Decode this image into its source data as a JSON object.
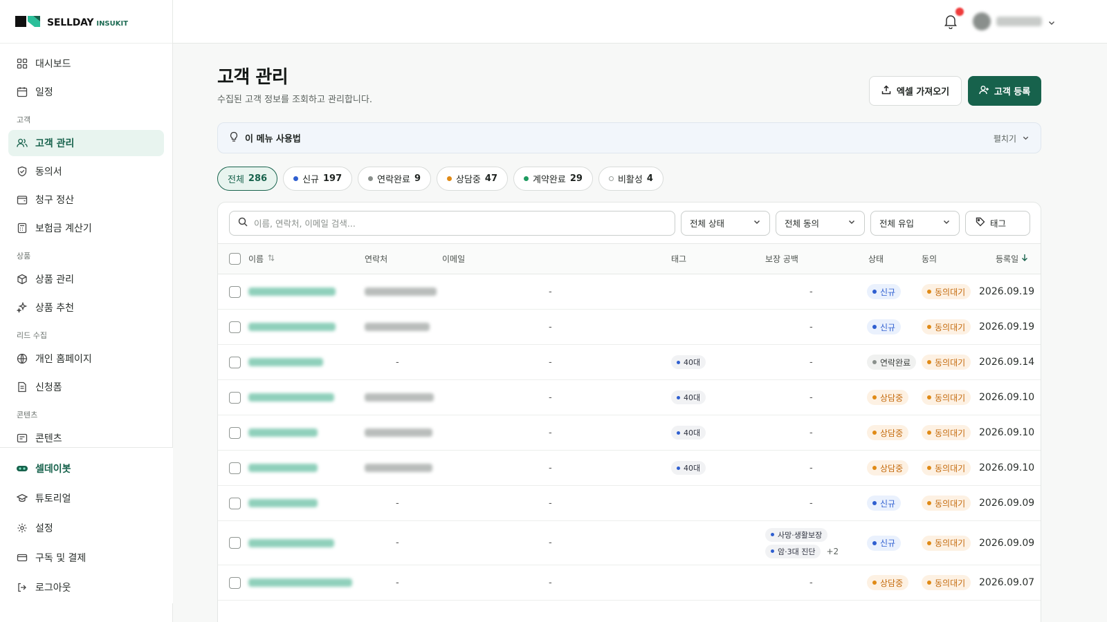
{
  "brand": {
    "name": "SELLDAY",
    "sub": "INSUKIT",
    "color": "#17624c"
  },
  "sidebar": {
    "items_top": [
      {
        "label": "대시보드",
        "icon": "grid-icon"
      },
      {
        "label": "일정",
        "icon": "calendar-icon"
      }
    ],
    "section_customer": "고객",
    "items_customer": [
      {
        "label": "고객 관리",
        "icon": "users-icon",
        "active": true
      },
      {
        "label": "동의서",
        "icon": "shield-icon"
      },
      {
        "label": "청구 정산",
        "icon": "wallet-icon"
      },
      {
        "label": "보험금 계산기",
        "icon": "calculator-icon"
      }
    ],
    "section_product": "상품",
    "items_product": [
      {
        "label": "상품 관리",
        "icon": "box-icon"
      },
      {
        "label": "상품 추천",
        "icon": "sparkle-icon"
      }
    ],
    "section_lead": "리드 수집",
    "items_lead": [
      {
        "label": "개인 홈페이지",
        "icon": "globe-icon"
      },
      {
        "label": "신청폼",
        "icon": "form-icon"
      }
    ],
    "section_content": "콘텐츠",
    "items_content": [
      {
        "label": "콘텐츠",
        "icon": "content-icon"
      }
    ],
    "bottom": [
      {
        "label": "셀데이봇",
        "icon": "bot-icon"
      },
      {
        "label": "튜토리얼",
        "icon": "graduation-icon"
      },
      {
        "label": "설정",
        "icon": "gear-icon"
      },
      {
        "label": "구독 및 결제",
        "icon": "card-icon"
      },
      {
        "label": "로그아웃",
        "icon": "logout-icon"
      }
    ]
  },
  "header": {
    "title": "고객 관리",
    "desc": "수집된 고객 정보를 조회하고 관리합니다.",
    "excel_btn": "엑셀 가져오기",
    "register_btn": "고객 등록"
  },
  "guide": {
    "label": "이 메뉴 사용법",
    "toggle": "펼치기"
  },
  "chips": [
    {
      "label": "전체",
      "count": "286",
      "dot": "",
      "active": true
    },
    {
      "label": "신규",
      "count": "197",
      "dot": "#2f5fd0"
    },
    {
      "label": "연락완료",
      "count": "9",
      "dot": "#8a908c"
    },
    {
      "label": "상담중",
      "count": "47",
      "dot": "#e08a16"
    },
    {
      "label": "계약완료",
      "count": "29",
      "dot": "#1e9a5f"
    },
    {
      "label": "비활성",
      "count": "4",
      "dot": "hollow"
    }
  ],
  "filters": {
    "search_placeholder": "이름, 연락처, 이메일 검색...",
    "status": "전체 상태",
    "consent": "전체 동의",
    "source": "전체 유입",
    "tag": "태그"
  },
  "table": {
    "columns": {
      "name": "이름",
      "phone": "연락처",
      "email": "이메일",
      "tag": "태그",
      "gap": "보장 공백",
      "status": "상태",
      "consent": "동의",
      "date": "등록일"
    },
    "rows": [
      {
        "phone": true,
        "email": "-",
        "tags": [],
        "gap": "-",
        "status": "신규",
        "consent": "동의대기",
        "date": "2026.09.19"
      },
      {
        "phone": true,
        "email": "-",
        "tags": [],
        "gap": "-",
        "status": "신규",
        "consent": "동의대기",
        "date": "2026.09.19"
      },
      {
        "phone": false,
        "email": "-",
        "tags": [
          "40대"
        ],
        "gap": "-",
        "status": "연락완료",
        "consent": "동의대기",
        "date": "2026.09.14"
      },
      {
        "phone": true,
        "email": "-",
        "tags": [
          "40대"
        ],
        "gap": "-",
        "status": "상담중",
        "consent": "동의대기",
        "date": "2026.09.10"
      },
      {
        "phone": true,
        "email": "-",
        "tags": [
          "40대"
        ],
        "gap": "-",
        "status": "상담중",
        "consent": "동의대기",
        "date": "2026.09.10"
      },
      {
        "phone": true,
        "email": "-",
        "tags": [
          "40대"
        ],
        "gap": "-",
        "status": "상담중",
        "consent": "동의대기",
        "date": "2026.09.10"
      },
      {
        "phone": false,
        "email": "-",
        "tags": [],
        "gap": "-",
        "status": "신규",
        "consent": "동의대기",
        "date": "2026.09.09"
      },
      {
        "phone": false,
        "email": "-",
        "tags": [],
        "gap_tags": [
          "사망·생활보장",
          "암·3대 진단"
        ],
        "gap_more": "+2",
        "status": "신규",
        "consent": "동의대기",
        "date": "2026.09.09"
      },
      {
        "phone": false,
        "email": "-",
        "tags": [],
        "gap": "-",
        "status": "상담중",
        "consent": "동의대기",
        "date": "2026.09.07"
      }
    ]
  }
}
